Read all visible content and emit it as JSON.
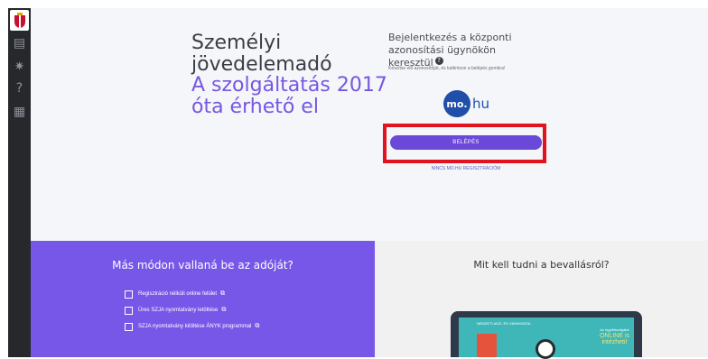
{
  "sidebar": {
    "icons": [
      "app-logo",
      "document-icon",
      "accessibility-icon",
      "help-icon",
      "calculator-icon"
    ]
  },
  "hero": {
    "title_line1": "Személyi",
    "title_line2": "jövedelemadó",
    "accent_line1": "A szolgáltatás 2017",
    "accent_line2": "óta érhető el"
  },
  "login": {
    "title": "Bejelentkezés a központi azonosítási ügynökön keresztül",
    "info_badge": "?",
    "description": "Készítse elő azonosítóját, és kattintson a belépés gombra!",
    "logo_circle": "mo.",
    "logo_text": "hu",
    "button_label": "BELÉPÉS",
    "register_link": "NINCS MO.HU REGISZTRÁCIÓM"
  },
  "other_ways": {
    "heading": "Más módon vallaná be az adóját?",
    "links": [
      "Regisztráció nélküli online felület",
      "Üres SZJA nyomtatvány letöltése",
      "SZJA nyomtatvány kitöltése ÁNYK programmal"
    ]
  },
  "info": {
    "heading": "Mit kell tudni a bevallásról?",
    "image_text_left": "NEMZETI ADÓ- ÉS VÁMHIVATAL",
    "image_text_right_small": "Az ügyfélszolgálat",
    "image_text_right_big": "ONLINE is intézheti!"
  },
  "colors": {
    "accent": "#7857e0",
    "button": "#6a48d8",
    "highlight": "#e1131f",
    "purple_panel": "#7757e8"
  }
}
